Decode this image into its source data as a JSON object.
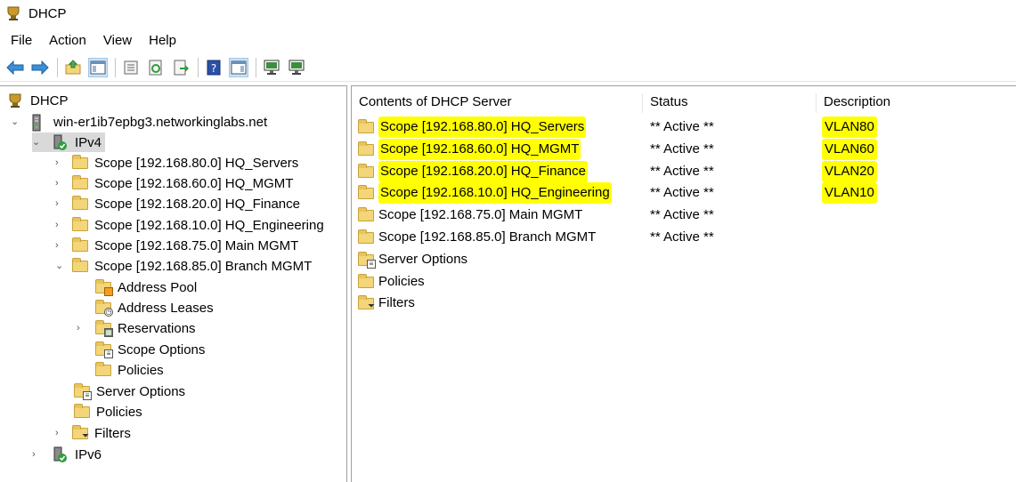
{
  "window": {
    "title": "DHCP"
  },
  "menu": [
    "File",
    "Action",
    "View",
    "Help"
  ],
  "toolbar_icons": [
    "back-arrow-icon",
    "forward-arrow-icon",
    "up-folder-icon",
    "show-hide-tree-icon",
    "properties-icon",
    "refresh-icon",
    "export-list-icon",
    "help-icon",
    "show-action-pane-icon",
    "display-statistics-icon",
    "authorize-server-icon"
  ],
  "tree": {
    "root": "DHCP",
    "server": "win-er1ib7epbg3.networkinglabs.net",
    "ipv4": "IPv4",
    "scopes": [
      "Scope [192.168.80.0] HQ_Servers",
      "Scope [192.168.60.0] HQ_MGMT",
      "Scope [192.168.20.0] HQ_Finance",
      "Scope [192.168.10.0] HQ_Engineering",
      "Scope [192.168.75.0] Main MGMT",
      "Scope [192.168.85.0] Branch MGMT"
    ],
    "scope_children": [
      "Address Pool",
      "Address Leases",
      "Reservations",
      "Scope Options",
      "Policies"
    ],
    "ipv4_children": [
      "Server Options",
      "Policies",
      "Filters"
    ],
    "ipv6": "IPv6"
  },
  "list": {
    "columns": [
      "Contents of DHCP Server",
      "Status",
      "Description"
    ],
    "rows": [
      {
        "name": "Scope [192.168.80.0] HQ_Servers",
        "status": "** Active **",
        "description": "VLAN80",
        "highlight": true
      },
      {
        "name": "Scope [192.168.60.0] HQ_MGMT",
        "status": "** Active **",
        "description": "VLAN60",
        "highlight": true
      },
      {
        "name": "Scope [192.168.20.0] HQ_Finance",
        "status": "** Active **",
        "description": "VLAN20",
        "highlight": true
      },
      {
        "name": "Scope [192.168.10.0] HQ_Engineering",
        "status": "** Active **",
        "description": "VLAN10",
        "highlight": true
      },
      {
        "name": "Scope [192.168.75.0] Main MGMT",
        "status": "** Active **",
        "description": "",
        "highlight": false
      },
      {
        "name": "Scope [192.168.85.0] Branch MGMT",
        "status": "** Active **",
        "description": "",
        "highlight": false
      },
      {
        "name": "Server Options",
        "status": "",
        "description": "",
        "highlight": false
      },
      {
        "name": "Policies",
        "status": "",
        "description": "",
        "highlight": false
      },
      {
        "name": "Filters",
        "status": "",
        "description": "",
        "highlight": false
      }
    ]
  },
  "colors": {
    "highlight": "#ffff00",
    "selection": "#d9d9d9",
    "folder": "#f3d57a"
  }
}
